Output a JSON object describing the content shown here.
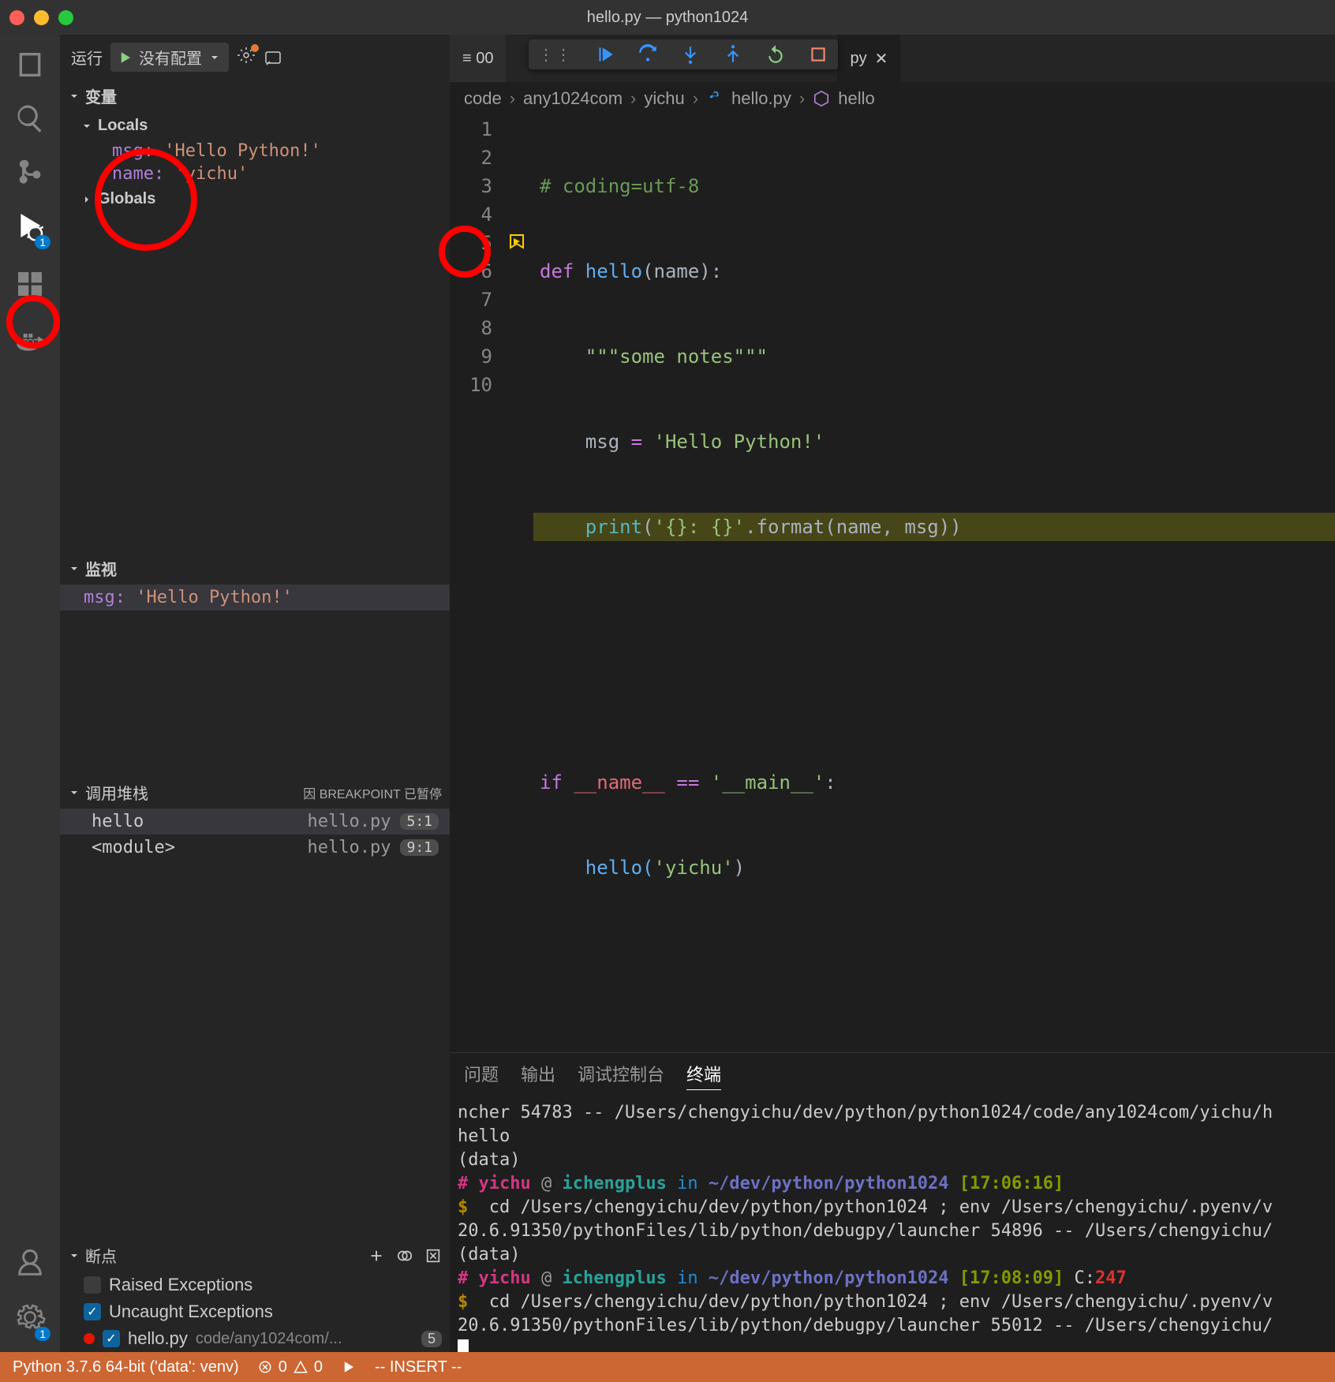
{
  "window": {
    "title": "hello.py — python1024"
  },
  "activity": {
    "debug_badge": "1",
    "settings_badge": "1"
  },
  "debug": {
    "run_label": "运行",
    "config": "没有配置",
    "sections": {
      "variables": "变量",
      "locals": "Locals",
      "globals": "Globals",
      "watch": "监视",
      "callstack": "调用堆栈",
      "breakpoints": "断点"
    },
    "locals": [
      {
        "k": "msg:",
        "v": "'Hello Python!'"
      },
      {
        "k": "name:",
        "v": "'yichu'"
      }
    ],
    "watch": {
      "k": "msg:",
      "v": "'Hello Python!'"
    },
    "paused_reason": "因 BREAKPOINT 已暂停",
    "callstack": [
      {
        "name": "hello",
        "file": "hello.py",
        "pos": "5:1"
      },
      {
        "name": "<module>",
        "file": "hello.py",
        "pos": "9:1"
      }
    ],
    "bp": {
      "raised": {
        "checked": false,
        "label": "Raised Exceptions"
      },
      "uncaught": {
        "checked": true,
        "label": "Uncaught Exceptions"
      },
      "file": {
        "checked": true,
        "label": "hello.py",
        "path": "code/any1024com/...",
        "count": "5"
      }
    }
  },
  "tabs": {
    "left_hint": "≡ 00",
    "file_suffix": "py",
    "close": "✕"
  },
  "breadcrumbs": {
    "p1": "code",
    "p2": "any1024com",
    "p3": "yichu",
    "p4": "hello.py",
    "p5": "hello"
  },
  "code": {
    "lines": [
      "1",
      "2",
      "3",
      "4",
      "5",
      "6",
      "7",
      "8",
      "9",
      "10"
    ],
    "l1_a": "# coding=utf-8",
    "l2_a": "def ",
    "l2_b": "hello",
    "l2_c": "(name):",
    "l3_a": "\"\"\"some notes\"\"\"",
    "l4_a": "msg ",
    "l4_b": "= ",
    "l4_c": "'Hello Python!'",
    "l5_a": "print",
    "l5_b": "(",
    "l5_c": "'{}: {}'",
    "l5_d": ".format(name, msg))",
    "l8_a": "if ",
    "l8_b": "__name__ ",
    "l8_c": "== ",
    "l8_d": "'__main__'",
    "l8_e": ":",
    "l9_a": "hello(",
    "l9_b": "'yichu'",
    "l9_c": ")"
  },
  "panel": {
    "tabs": {
      "problems": "问题",
      "output": "输出",
      "debug": "调试控制台",
      "terminal": "终端"
    },
    "t": {
      "l1": "ncher 54783 -- /Users/chengyichu/dev/python/python1024/code/any1024com/yichu/h",
      "l2": "hello",
      "l3": "(data)",
      "p1_u": "# yichu",
      "p1_at": " @ ",
      "p1_h": "ichengplus",
      "p1_in": " in ",
      "p1_p": "~/dev/python/python1024",
      "p1_t": " [17:06:16]",
      "cd1_a": "$",
      "cd1_b": "  cd /Users/chengyichu/dev/python/python1024 ; env /Users/chengyichu/.pyenv/v",
      "cd1_c": "20.6.91350/pythonFiles/lib/python/debugpy/launcher 54896 -- /Users/chengyichu/",
      "l7": "(data)",
      "p2_u": "# yichu",
      "p2_at": " @ ",
      "p2_h": "ichengplus",
      "p2_in": " in ",
      "p2_p": "~/dev/python/python1024",
      "p2_t": " [17:08:09]",
      "p2_c": " C:",
      "p2_r": "247",
      "cd2_a": "$",
      "cd2_b": "  cd /Users/chengyichu/dev/python/python1024 ; env /Users/chengyichu/.pyenv/v",
      "cd2_c": "20.6.91350/pythonFiles/lib/python/debugpy/launcher 55012 -- /Users/chengyichu/"
    }
  },
  "status": {
    "python": "Python 3.7.6 64-bit ('data': venv)",
    "err": "0",
    "warn": "0",
    "mode": "-- INSERT --"
  }
}
